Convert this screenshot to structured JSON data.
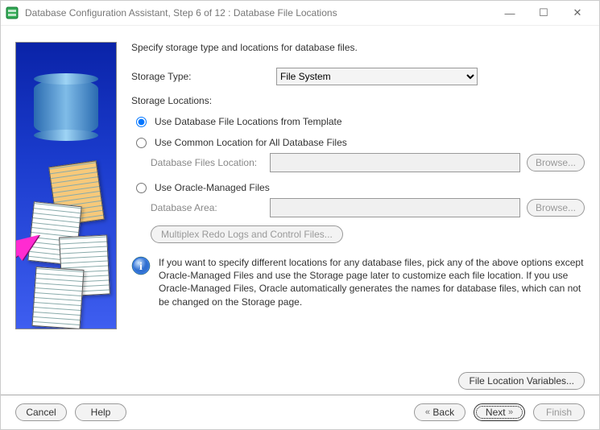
{
  "window": {
    "title": "Database Configuration Assistant, Step 6 of 12 : Database File Locations"
  },
  "instruction": "Specify storage type and locations for database files.",
  "labels": {
    "storage_type": "Storage Type:",
    "storage_locations": "Storage Locations:",
    "db_files_location": "Database Files Location:",
    "db_area": "Database Area:"
  },
  "storage_type": {
    "selected": "File System"
  },
  "options": {
    "tmpl": "Use Database File Locations from Template",
    "common": "Use Common Location for All Database Files",
    "omf": "Use Oracle-Managed Files"
  },
  "buttons": {
    "browse": "Browse...",
    "multiplex": "Multiplex Redo Logs and Control Files...",
    "file_location_vars": "File Location Variables...",
    "cancel": "Cancel",
    "help": "Help",
    "back": "Back",
    "next": "Next",
    "finish": "Finish"
  },
  "info": "If you want to specify different locations for any database files, pick any of the above options except Oracle-Managed Files and use the Storage page later to customize each file location. If you use Oracle-Managed Files, Oracle automatically generates the names for database files, which can not be changed on the Storage page."
}
